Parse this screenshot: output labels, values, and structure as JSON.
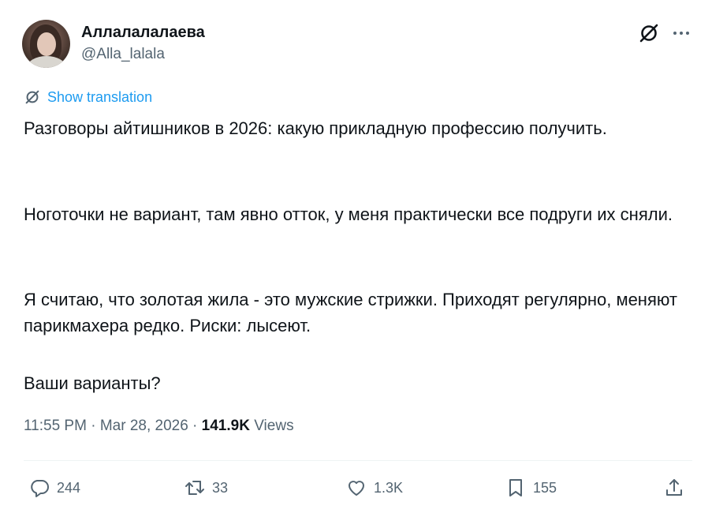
{
  "author": {
    "display_name": "Аллалалалаева",
    "handle": "@Alla_lalala"
  },
  "header_icons": [
    "grok-icon",
    "more-icon"
  ],
  "translation": {
    "label": "Show translation"
  },
  "tweet": {
    "paragraphs": [
      "Разговоры айтишников в 2026: какую прикладную профессию получить.",
      "Ноготочки не вариант, там явно отток, у меня практически все подруги их сняли.",
      "Я считаю, что золотая жила - это мужские стрижки. Приходят регулярно, меняют парикмахера редко. Риски: лысеют.",
      "Ваши варианты?"
    ]
  },
  "meta": {
    "time": "11:55 PM",
    "separator": " · ",
    "date": "Mar 28, 2026",
    "views_count": "141.9K",
    "views_label": " Views"
  },
  "actions": {
    "replies": "244",
    "reposts": "33",
    "likes": "1.3K",
    "bookmarks": "155"
  },
  "colors": {
    "text": "#0f1419",
    "secondary": "#536471",
    "link": "#1d9bf0",
    "divider": "#eff3f4"
  }
}
